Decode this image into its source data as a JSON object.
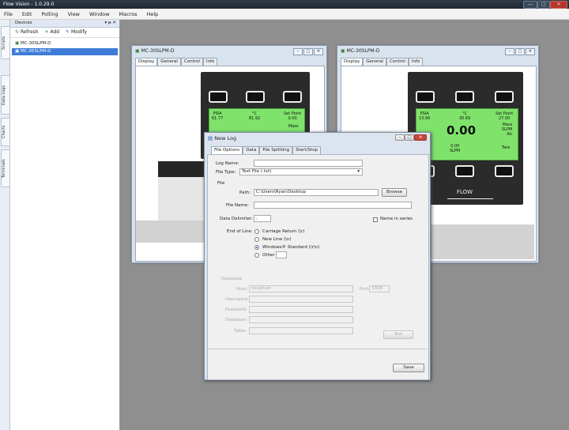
{
  "app": {
    "title": "Flow Vision - 1.0.29.0",
    "window_controls": [
      "—",
      "□",
      "✕"
    ]
  },
  "menu": [
    "File",
    "Edit",
    "Polling",
    "View",
    "Window",
    "Macros",
    "Help"
  ],
  "left_tabs": [
    "Scripts",
    "Data Logs",
    "Charts",
    "Terminals"
  ],
  "devices_panel": {
    "title": "Devices",
    "header_controls": [
      "▾",
      "ᵽ",
      "✕"
    ],
    "toolbar": {
      "refresh": "Refresh",
      "add": "Add",
      "modify": "Modify"
    },
    "items": [
      {
        "label": "MC-30SLPM-D",
        "selected": false
      },
      {
        "label": "MC-05SLPM-D",
        "selected": true
      }
    ]
  },
  "device_windows": [
    {
      "title": "MC-30SLPM-D",
      "tabs": [
        "Display",
        "General",
        "Control",
        "Info"
      ],
      "active_tab": "Display",
      "lcd": {
        "psia_label": "PSIA",
        "psia_value": "61.77",
        "temp_label": "°C",
        "temp_value": "81.92",
        "setpoint_label": "Set Point",
        "setpoint_value": "0.00",
        "mass_label": "Mass"
      }
    },
    {
      "title": "MC-30SLPM-D",
      "tabs": [
        "Display",
        "General",
        "Control",
        "Info"
      ],
      "active_tab": "Display",
      "lcd": {
        "psia_label": "PSIA",
        "psia_value": "13.66",
        "temp_label": "°C",
        "temp_value": "30.69",
        "setpoint_label": "Set Point",
        "setpoint_value": "27.00",
        "main_value": "0.00",
        "mass_label": "Mass",
        "unit_label": "SLPM",
        "gas_label": "Air",
        "secondary_value": "0.00",
        "secondary_unit": "SLPM",
        "tare_label": "Tare"
      },
      "flow_label": "FLOW"
    }
  ],
  "new_log_dialog": {
    "title": "New Log",
    "tabs": [
      "File Options",
      "Data",
      "File Splitting",
      "Start/Stop"
    ],
    "active_tab": "File Options",
    "log_name_label": "Log Name:",
    "log_name_value": "",
    "file_type_label": "File Type:",
    "file_type_value": "Text File (.txt)",
    "file_group_label": "File",
    "path_label": "Path:",
    "path_value": "C:\\Users\\Ryan\\Desktop",
    "browse_button": "Browse",
    "file_name_label": "File Name:",
    "file_name_value": "",
    "delimiter_label": "Data Delimiter:",
    "delimiter_value": ",",
    "name_in_series_label": "Name in series",
    "eol_label": "End of Line:",
    "eol_options": [
      "Carriage Return (\\r)",
      "New Line (\\n)",
      "Windows® Standard (\\r\\n)",
      "Other"
    ],
    "eol_selected": 2,
    "database_label": "Database",
    "host_label": "Host:",
    "host_value": "localhost",
    "port_label": "Port:",
    "port_value": "3306",
    "username_label": "Username:",
    "password_label": "Password:",
    "database_field_label": "Database:",
    "table_label": "Table:",
    "test_button": "Test",
    "save_button": "Save"
  },
  "colors": {
    "lcd_green": "#7fe36b",
    "selection_blue": "#3d7bd6",
    "titlebar": "#2f3a48"
  }
}
